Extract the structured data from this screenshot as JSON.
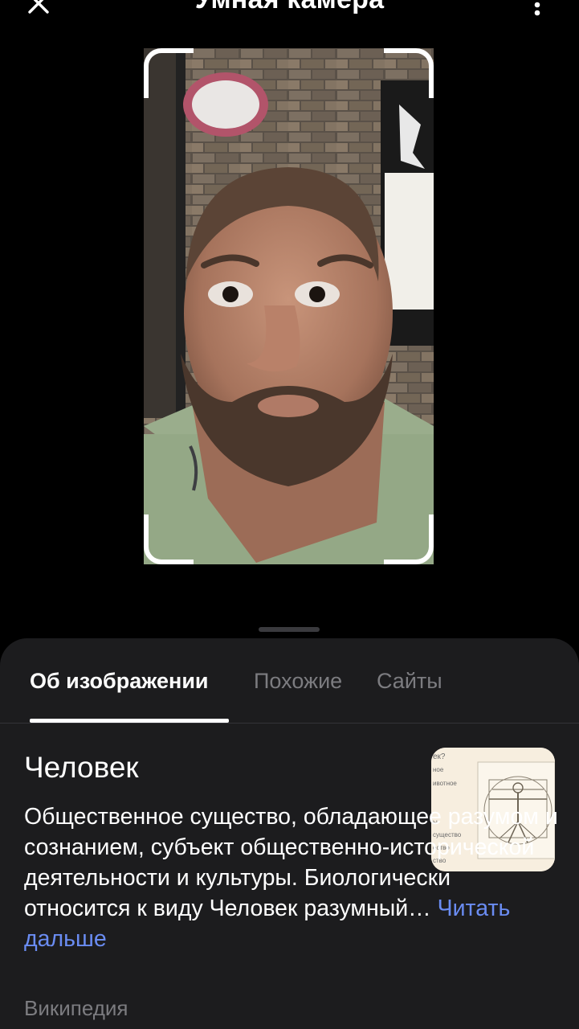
{
  "header": {
    "title": "Умная камера",
    "close_icon": "close-icon",
    "more_icon": "more-vertical-icon"
  },
  "sheet": {
    "tabs": [
      {
        "label": "Об изображении",
        "active": true
      },
      {
        "label": "Похожие",
        "active": false
      },
      {
        "label": "Сайты",
        "active": false
      }
    ],
    "result": {
      "title": "Человек",
      "description": "Общественное существо, обладающее разумом и сознанием, субъект общественно-исторической деятельности и культуры. Биологически относится к виду Человек разумный…",
      "read_more": "Читать дальше",
      "source": "Википедия"
    }
  },
  "colors": {
    "background": "#000000",
    "sheet": "#1c1c1e",
    "link": "#6a8cf2",
    "muted": "#7c7c80"
  }
}
